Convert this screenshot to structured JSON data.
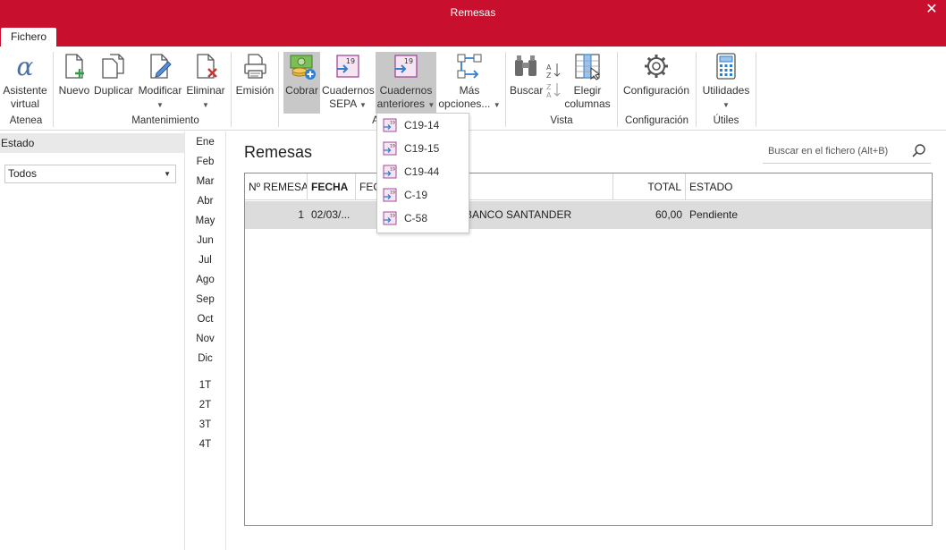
{
  "window": {
    "title": "Remesas",
    "close_glyph": "✕"
  },
  "tabs": {
    "fichero": "Fichero"
  },
  "ribbon": {
    "asistente": {
      "line1": "Asistente",
      "line2": "virtual",
      "icon": "alpha-icon"
    },
    "nuevo": "Nuevo",
    "duplicar": "Duplicar",
    "modificar": "Modificar",
    "eliminar": "Eliminar",
    "emision": "Emisión",
    "cobrar": "Cobrar",
    "cuadernos_sepa": {
      "line1": "Cuadernos",
      "line2": "SEPA"
    },
    "cuadernos_anteriores": {
      "line1": "Cuadernos",
      "line2": "anteriores"
    },
    "mas_opciones": {
      "line1": "Más",
      "line2": "opciones..."
    },
    "buscar": "Buscar",
    "elegir_columnas": {
      "line1": "Elegir",
      "line2": "columnas"
    },
    "configuracion": "Configuración",
    "utilidades": "Utilidades",
    "groups": {
      "atenea": "Atenea",
      "mantenimiento": "Mantenimiento",
      "acciones": "A",
      "vista": "Vista",
      "configuracion": "Configuración",
      "utiles": "Útiles"
    }
  },
  "left_panel": {
    "header": "Estado",
    "select_value": "Todos"
  },
  "months": [
    "Ene",
    "Feb",
    "Mar",
    "Abr",
    "May",
    "Jun",
    "Jul",
    "Ago",
    "Sep",
    "Oct",
    "Nov",
    "Dic"
  ],
  "quarters": [
    "1T",
    "2T",
    "3T",
    "4T"
  ],
  "main": {
    "title": "Remesas",
    "search_placeholder": "Buscar en el fichero (Alt+B)"
  },
  "table": {
    "headers": {
      "nro": "Nº REMESA",
      "fecha": "FECHA",
      "fec": "FEC",
      "o": "O",
      "total": "TOTAL",
      "estado": "ESTADO"
    },
    "rows": [
      {
        "nro": "1",
        "fecha": "02/03/...",
        "banco": "BANCO SANTANDER",
        "total": "60,00",
        "estado": "Pendiente"
      }
    ]
  },
  "dropdown": {
    "items": [
      "C19-14",
      "C19-15",
      "C19-44",
      "C-19",
      "C-58"
    ]
  },
  "colors": {
    "accent": "#c8102e",
    "selected_bg": "#c8c8c8",
    "row_bg": "#dcdcdc"
  }
}
